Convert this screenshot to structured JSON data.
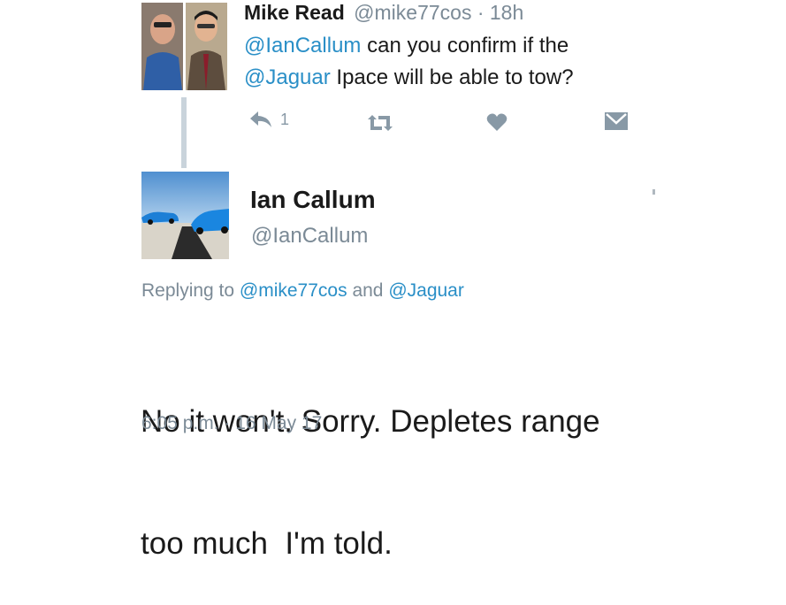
{
  "parent_tweet": {
    "author_name": "Mike Read",
    "handle_time": "@mike77cos · 18h",
    "mention1": "@IanCallum",
    "text1": " can you confirm if the",
    "mention2": "@Jaguar",
    "text2": " Ipace will be able to tow?",
    "reply_count": "1"
  },
  "reply_tweet": {
    "author_name": "Ian Callum",
    "handle": "@IanCallum",
    "replying_prefix": "Replying to ",
    "replying_to_1": "@mike77cos",
    "replying_and": " and ",
    "replying_to_2": "@Jaguar",
    "body_line1": "No it won't. Sorry. Depletes range",
    "body_line2": "too much  I'm told.",
    "timestamp": "6:05 p.m. · 16 May 17"
  },
  "colors": {
    "mention": "#2a8fc7",
    "muted": "#7b8a96",
    "icon": "#8899a6",
    "thread_line": "#c9d3db"
  },
  "icons": [
    "reply-icon",
    "retweet-icon",
    "like-icon",
    "direct-message-icon"
  ]
}
